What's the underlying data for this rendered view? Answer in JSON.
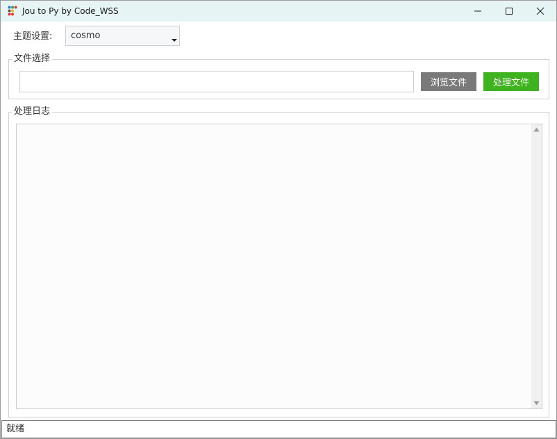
{
  "window": {
    "title": "Jou to Py by Code_WSS",
    "icon": "app-logo-icon",
    "controls": [
      "minimize-icon",
      "maximize-icon",
      "close-icon"
    ]
  },
  "theme": {
    "label": "主题设置:",
    "selected": "cosmo"
  },
  "file_section": {
    "title": "文件选择",
    "path_value": "",
    "browse_label": "浏览文件",
    "process_label": "处理文件"
  },
  "log_section": {
    "title": "处理日志",
    "content": ""
  },
  "status": {
    "text": "就绪"
  },
  "colors": {
    "titlebar_bg": "#e6f4f4",
    "browse_button": "#7a7a7a",
    "process_button": "#3fb21f"
  }
}
